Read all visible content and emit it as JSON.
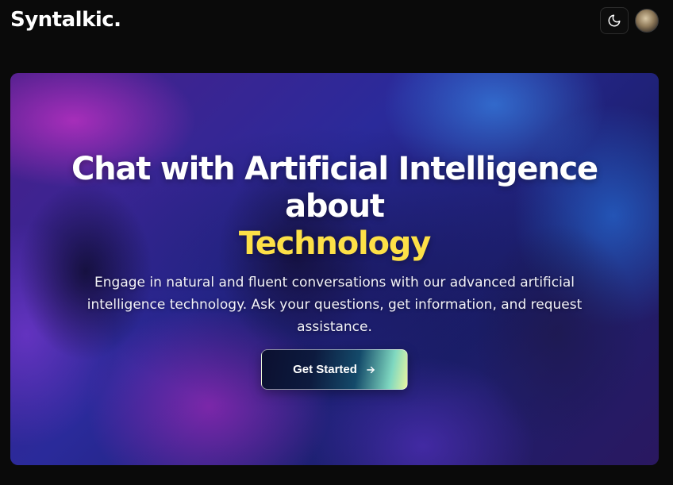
{
  "header": {
    "logo_text": "Syntalkic.",
    "theme_toggle_icon": "moon-icon",
    "avatar_icon": "user-avatar"
  },
  "hero": {
    "headline_line1": "Chat with Artificial Intelligence",
    "headline_line2": "about",
    "headline_highlight": "Technology",
    "description": "Engage in natural and fluent conversations with our advanced artificial intelligence technology. Ask your questions, get information, and request assistance.",
    "cta_label": "Get Started",
    "cta_icon": "arrow-right-icon"
  },
  "colors": {
    "page_background": "#0a0a0a",
    "highlight": "#fde047",
    "text": "#ffffff"
  }
}
